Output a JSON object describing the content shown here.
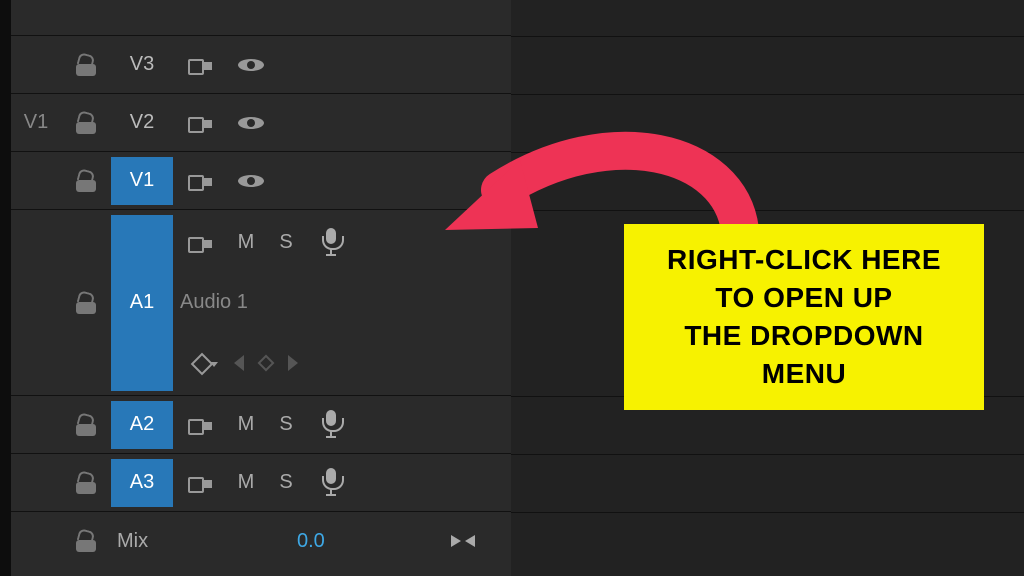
{
  "tracks": {
    "v3": {
      "label": "V3"
    },
    "v2": {
      "src": "V1",
      "label": "V2"
    },
    "v1": {
      "label": "V1"
    },
    "a1": {
      "label": "A1",
      "name": "Audio 1",
      "mute": "M",
      "solo": "S"
    },
    "a2": {
      "label": "A2",
      "mute": "M",
      "solo": "S"
    },
    "a3": {
      "label": "A3",
      "mute": "M",
      "solo": "S"
    },
    "mix": {
      "label": "Mix",
      "value": "0.0"
    }
  },
  "callout": {
    "line1": "RIGHT-CLICK HERE",
    "line2": "TO OPEN UP",
    "line3": "THE DROPDOWN",
    "line4": "MENU"
  }
}
